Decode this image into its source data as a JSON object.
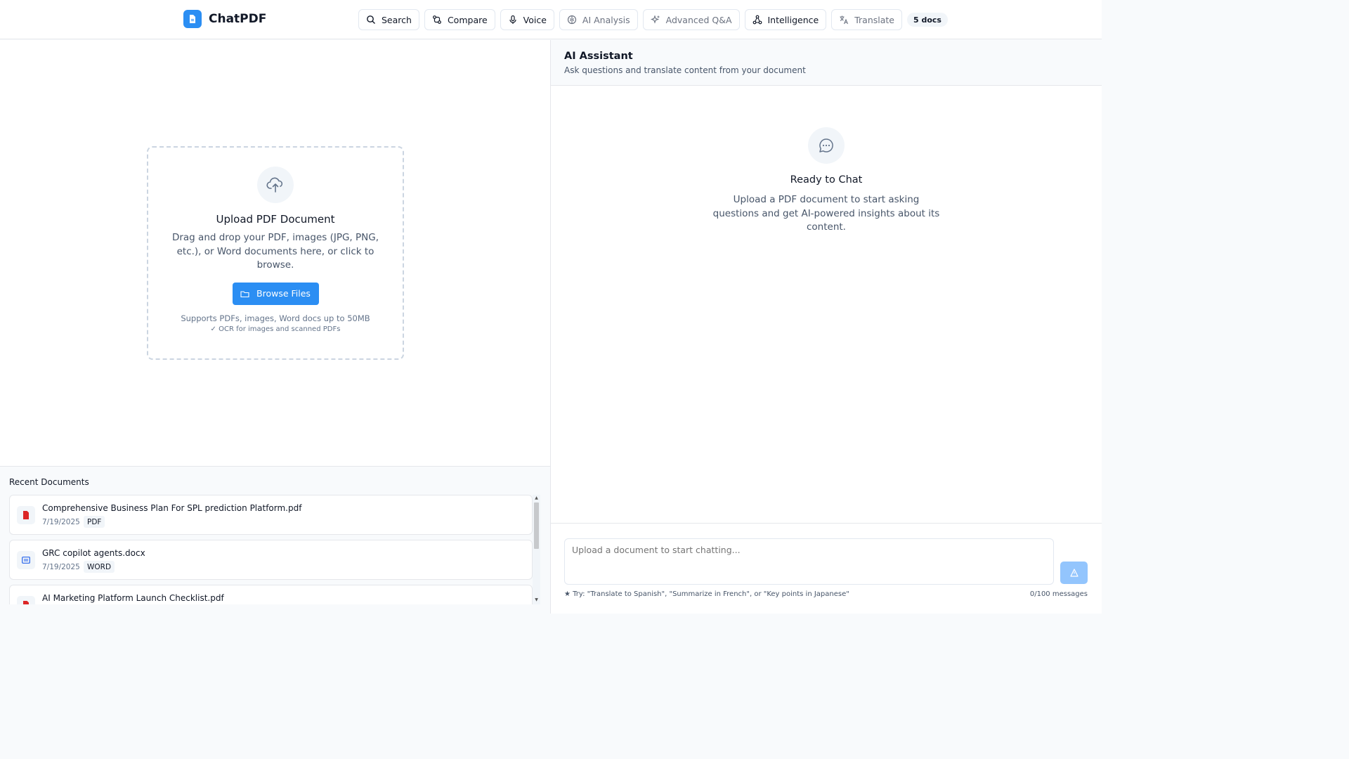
{
  "app": {
    "name": "ChatPDF"
  },
  "nav": {
    "items": [
      {
        "label": "Search",
        "icon": "search-icon",
        "muted": false
      },
      {
        "label": "Compare",
        "icon": "compare-icon",
        "muted": false
      },
      {
        "label": "Voice",
        "icon": "microphone-icon",
        "muted": false
      },
      {
        "label": "AI Analysis",
        "icon": "brain-icon",
        "muted": true
      },
      {
        "label": "Advanced Q&A",
        "icon": "sparkles-icon",
        "muted": true
      },
      {
        "label": "Intelligence",
        "icon": "network-icon",
        "muted": false
      },
      {
        "label": "Translate",
        "icon": "translate-icon",
        "muted": true
      }
    ],
    "docs_badge": "5 docs"
  },
  "upload": {
    "title": "Upload PDF Document",
    "description": "Drag and drop your PDF, images (JPG, PNG, etc.), or Word documents here, or click to browse.",
    "browse_label": "Browse Files",
    "support_text": "Supports PDFs, images, Word docs up to 50MB",
    "ocr_text": "✓ OCR for images and scanned PDFs"
  },
  "recent": {
    "title": "Recent Documents",
    "items": [
      {
        "name": "Comprehensive Business Plan For SPL prediction Platform.pdf",
        "date": "7/19/2025",
        "type": "PDF"
      },
      {
        "name": "GRC copilot agents.docx",
        "date": "7/19/2025",
        "type": "WORD"
      },
      {
        "name": "AI Marketing Platform Launch Checklist.pdf",
        "date": "",
        "type": ""
      }
    ]
  },
  "assistant": {
    "title": "AI Assistant",
    "subtitle": "Ask questions and translate content from your document",
    "ready_title": "Ready to Chat",
    "ready_desc": "Upload a PDF document to start asking questions and get AI-powered insights about its content.",
    "input_placeholder": "Upload a document to start chatting...",
    "hint": "★ Try: \"Translate to Spanish\", \"Summarize in French\", or \"Key points in Japanese\"",
    "counter": "0/100 messages"
  },
  "colors": {
    "accent": "#2b8ef3",
    "send_disabled": "#93c5fd",
    "pdf_icon": "#dc2626",
    "word_icon": "#2563eb"
  }
}
